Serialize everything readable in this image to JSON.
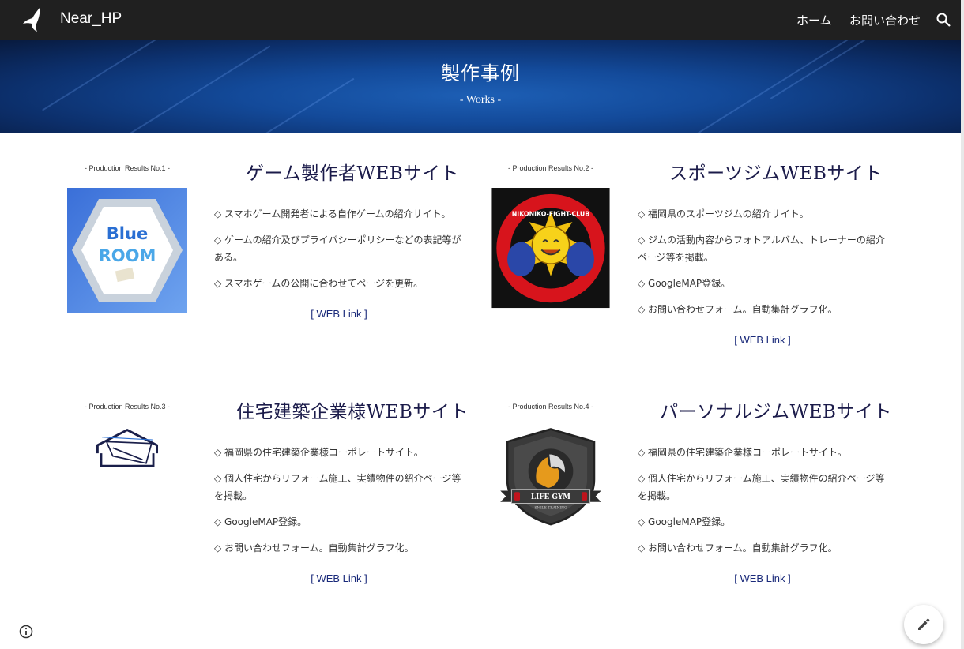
{
  "header": {
    "site_title": "Near_HP",
    "nav": [
      {
        "label": "ホーム"
      },
      {
        "label": "お問い合わせ"
      }
    ]
  },
  "banner": {
    "title": "製作事例",
    "subtitle": "- Works -"
  },
  "works": [
    {
      "label": "- Production Results  No.1 -",
      "title": "ゲーム製作者WEBサイト",
      "image_text": [
        "Blue",
        "ROOM"
      ],
      "bullets": [
        "◇ スマホゲーム開発者による自作ゲームの紹介サイト。",
        "◇ ゲームの紹介及びプライバシーポリシーなどの表記等がある。",
        "◇ スマホゲームの公開に合わせてページを更新。"
      ],
      "link": "[ WEB Link ]"
    },
    {
      "label": "- Production Results  No.2 -",
      "title": "スポーツジムWEBサイト",
      "image_text": [
        "NIKONIKO-FIGHT-CLUB"
      ],
      "bullets": [
        "◇ 福岡県のスポーツジムの紹介サイト。",
        "◇ ジムの活動内容からフォトアルバム、トレーナーの紹介ページ等を掲載。",
        "◇ GoogleMAP登録。",
        "◇ お問い合わせフォーム。自動集計グラフ化。"
      ],
      "link": "[ WEB Link ]"
    },
    {
      "label": "- Production Results  No.3 -",
      "title": "住宅建築企業様WEBサイト",
      "image_text": [],
      "bullets": [
        "◇ 福岡県の住宅建築企業様コーポレートサイト。",
        "◇ 個人住宅からリフォーム施工、実績物件の紹介ページ等を掲載。",
        "◇ GoogleMAP登録。",
        "◇ お問い合わせフォーム。自動集計グラフ化。"
      ],
      "link": "[ WEB Link ]"
    },
    {
      "label": "- Production Results  No.4 -",
      "title": "パーソナルジムWEBサイト",
      "image_text": [
        "LIFE GYM",
        "SMILE TRAINING"
      ],
      "bullets": [
        "◇ 福岡県の住宅建築企業様コーポレートサイト。",
        "◇ 個人住宅からリフォーム施工、実績物件の紹介ページ等を掲載。",
        "◇ GoogleMAP登録。",
        "◇ お問い合わせフォーム。自動集計グラフ化。"
      ],
      "link": "[ WEB Link ]"
    }
  ],
  "icons": {
    "logo": "bird-logo-icon",
    "search": "search-icon",
    "info": "info-icon",
    "edit": "pencil-edit-icon"
  },
  "colors": {
    "topbar": "#202020",
    "banner": "#134a9a",
    "title_text": "#1b1b4a",
    "link_text": "#1a2a7a"
  }
}
